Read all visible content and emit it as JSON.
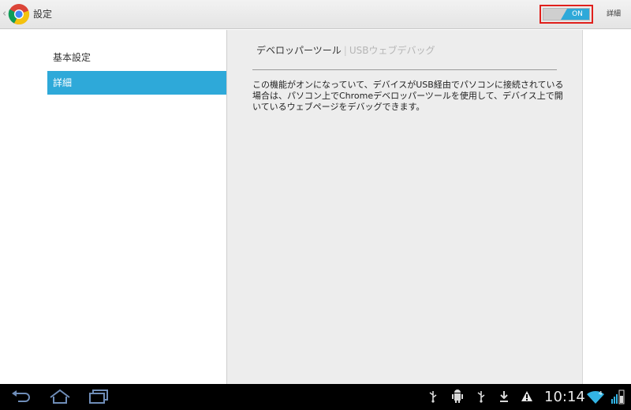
{
  "header": {
    "title": "設定",
    "toggle_label": "ON",
    "detail_label": "詳細"
  },
  "sidebar": {
    "items": [
      {
        "label": "基本設定",
        "selected": false
      },
      {
        "label": "詳細",
        "selected": true
      }
    ]
  },
  "main": {
    "breadcrumb": {
      "current": "デベロッパーツール",
      "next": "USBウェブデバッグ"
    },
    "description": "この機能がオンになっていて、デバイスがUSB経由でパソコンに接続されている場合は、パソコン上でChromeデベロッパーツールを使用して、デバイス上で開いているウェブページをデバッグできます。"
  },
  "system_bar": {
    "clock": "10:14",
    "status_icons": [
      "usb-icon",
      "android-debug-icon",
      "usb-icon",
      "download-icon",
      "warning-icon",
      "wifi-icon",
      "battery-icon"
    ]
  },
  "colors": {
    "accent": "#2ea9d9",
    "highlight": "#e0201c",
    "panel": "#ededed",
    "system_bar": "#000000"
  }
}
